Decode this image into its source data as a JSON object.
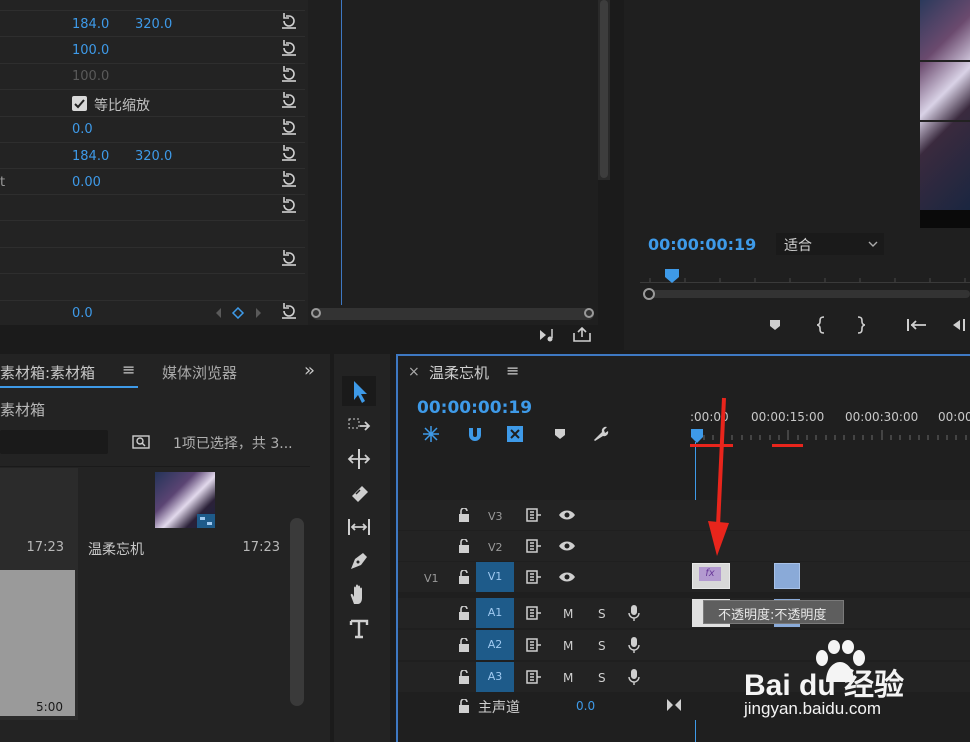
{
  "effect_controls": {
    "rows": [
      {
        "v1": "184.0",
        "v2": "320.0"
      },
      {
        "v1": "100.0"
      },
      {
        "v1": "100.0",
        "disabled": true
      },
      {
        "checkbox_label": "等比缩放"
      },
      {
        "v1": "0.0"
      },
      {
        "v1": "184.0",
        "v2": "320.0"
      },
      {
        "v1": "0.00",
        "prefix": "t"
      },
      {},
      {},
      {},
      {},
      {
        "v1": "0.0"
      }
    ]
  },
  "program_monitor": {
    "timecode": "00:00:00:19",
    "fit_label": "适合"
  },
  "project_panel": {
    "tab_active": "素材箱:素材箱",
    "tab_menu": "≡",
    "tab_other": "媒体浏览器",
    "overflow": "»",
    "breadcrumb": "素材箱",
    "selection_info": "1项已选择，共 3...",
    "items": [
      {
        "name": "",
        "duration": "17:23",
        "thumb_duration": "5:00"
      },
      {
        "name": "温柔忘机",
        "duration": "17:23"
      }
    ]
  },
  "timeline": {
    "close": "×",
    "sequence_name": "温柔忘机",
    "menu": "≡",
    "timecode": "00:00:00:19",
    "ruler": [
      ":00:00",
      "00:00:15:00",
      "00:00:30:00",
      "00:00"
    ],
    "video_tracks": [
      {
        "target": "",
        "name": "V3"
      },
      {
        "target": "",
        "name": "V2"
      },
      {
        "target": "V1",
        "name": "V1"
      }
    ],
    "audio_tracks": [
      {
        "name": "A1",
        "m": "M",
        "s": "S"
      },
      {
        "name": "A2",
        "m": "M",
        "s": "S"
      },
      {
        "name": "A3",
        "m": "M",
        "s": "S"
      }
    ],
    "master_label": "主声道",
    "master_value": "0.0",
    "clip_fx": "fx",
    "clip_tooltip": "不透明度:不透明度"
  },
  "watermark": {
    "brand": "Bai du 经验",
    "url": "jingyan.baidu.com"
  },
  "colors": {
    "accent": "#3e9ae8",
    "red": "#e8251c",
    "track_blue": "#1e5b8a",
    "clip": "#8aaad8"
  }
}
